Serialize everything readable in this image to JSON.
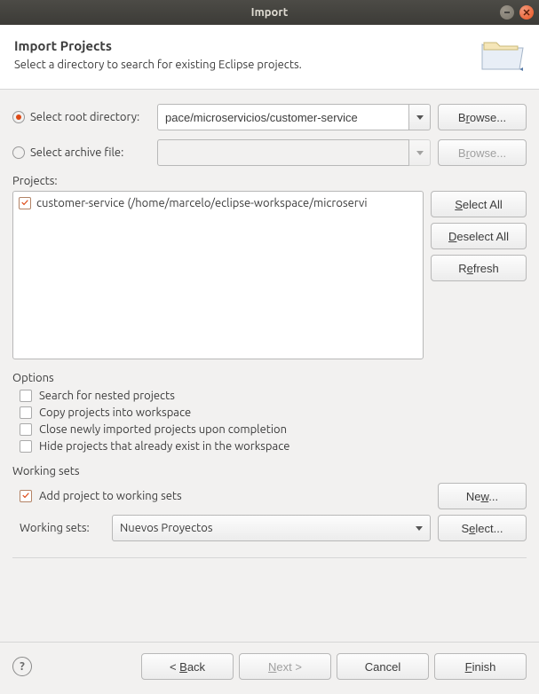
{
  "window": {
    "title": "Import"
  },
  "header": {
    "title": "Import Projects",
    "subtitle": "Select a directory to search for existing Eclipse projects."
  },
  "source": {
    "root_label": "Select root directory:",
    "root_value": "pace/microservicios/customer-service",
    "archive_label": "Select archive file:",
    "archive_value": "",
    "browse": "Browse..."
  },
  "projects": {
    "label": "Projects:",
    "items": [
      {
        "label": "customer-service (/home/marcelo/eclipse-workspace/microservi",
        "checked": true
      }
    ],
    "select_all": "Select All",
    "deselect_all": "Deselect All",
    "refresh": "Refresh"
  },
  "options": {
    "legend": "Options",
    "search_nested": "Search for nested projects",
    "copy": "Copy projects into workspace",
    "close": "Close newly imported projects upon completion",
    "hide": "Hide projects that already exist in the workspace"
  },
  "working_sets": {
    "legend": "Working sets",
    "add": "Add project to working sets",
    "new": "New...",
    "label": "Working sets:",
    "value": "Nuevos Proyectos",
    "select": "Select..."
  },
  "footer": {
    "back": "< Back",
    "next": "Next >",
    "cancel": "Cancel",
    "finish": "Finish"
  }
}
